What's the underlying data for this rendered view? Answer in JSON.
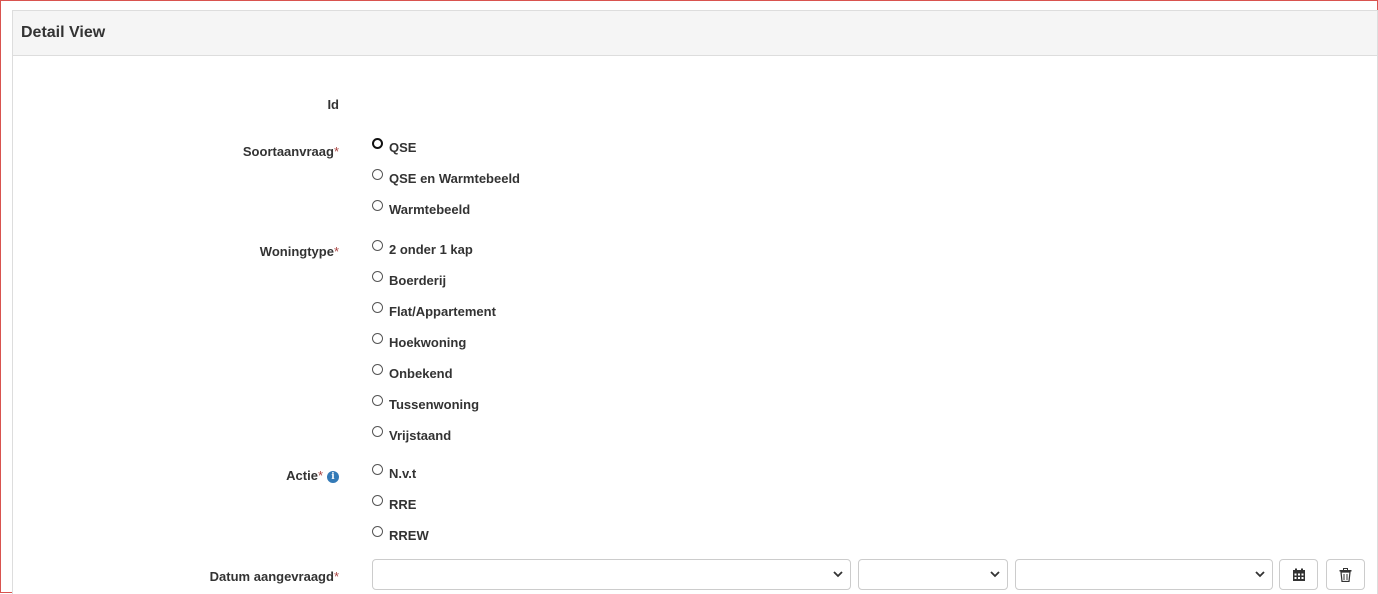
{
  "panel": {
    "title": "Detail View"
  },
  "fields": {
    "id": {
      "label": "Id"
    },
    "soortaanvraag": {
      "label": "Soortaanvraag",
      "required": "*",
      "options": [
        "QSE",
        "QSE en Warmtebeeld",
        "Warmtebeeld"
      ]
    },
    "woningtype": {
      "label": "Woningtype",
      "required": "*",
      "options": [
        "2 onder 1 kap",
        "Boerderij",
        "Flat/Appartement",
        "Hoekwoning",
        "Onbekend",
        "Tussenwoning",
        "Vrijstaand"
      ]
    },
    "actie": {
      "label": "Actie",
      "required": "*",
      "info_icon": "i",
      "options": [
        "N.v.t",
        "RRE",
        "RREW"
      ]
    },
    "datum_aangevraagd": {
      "label": "Datum aangevraagd",
      "required": "*"
    }
  },
  "icons": {
    "info": "info-circle-icon",
    "select_arrow": "chevron-down-icon",
    "calendar": "calendar-icon",
    "delete": "trash-icon"
  },
  "colors": {
    "required": "#a94442",
    "info": "#337ab7",
    "outer_border": "#d9534f",
    "heading_bg": "#f5f5f5"
  }
}
